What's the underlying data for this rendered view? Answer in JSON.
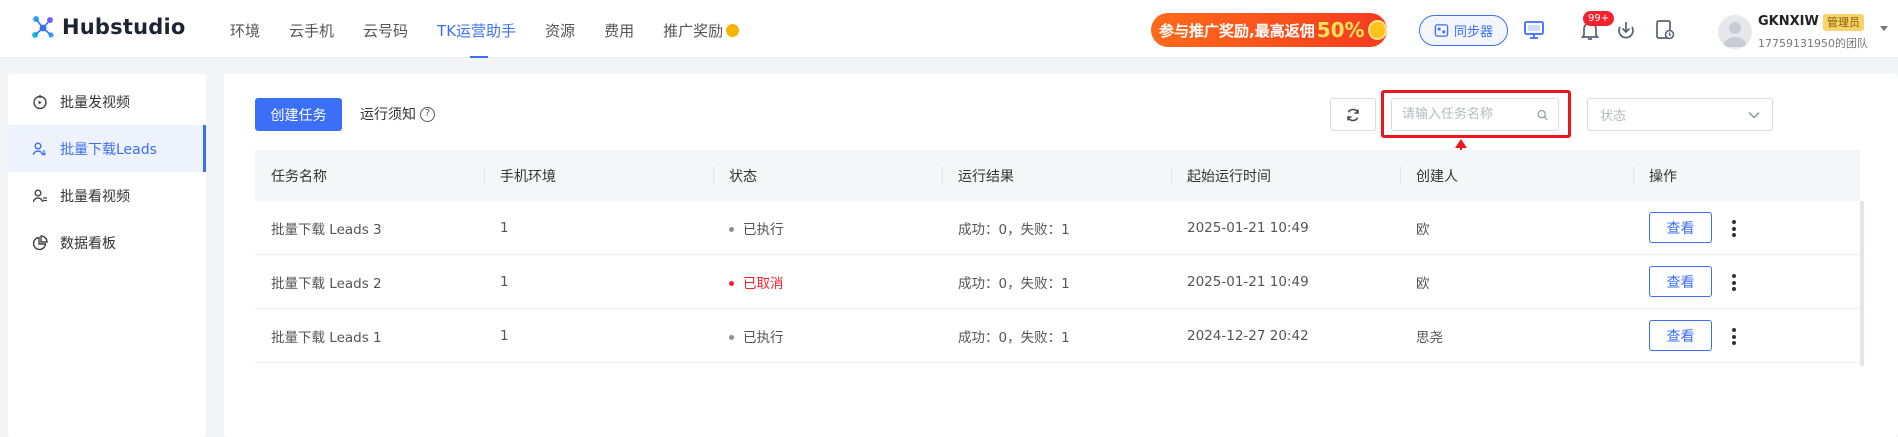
{
  "header": {
    "logo": "Hubstudio",
    "nav": [
      {
        "label": "环境",
        "active": false
      },
      {
        "label": "云手机",
        "active": false
      },
      {
        "label": "云号码",
        "active": false
      },
      {
        "label": "TK运营助手",
        "active": true
      },
      {
        "label": "资源",
        "active": false
      },
      {
        "label": "费用",
        "active": false
      },
      {
        "label": "推广奖励",
        "active": false
      }
    ],
    "promo": {
      "text": "参与推广奖励,最高返佣",
      "highlight": "50%"
    },
    "sync_label": "同步器",
    "notification_badge": "99+",
    "user": {
      "name": "GKNXIW",
      "role": "管理员",
      "team": "17759131950的团队"
    }
  },
  "sidebar": {
    "items": [
      {
        "label": "批量发视频",
        "icon": "upload-video-icon",
        "active": false
      },
      {
        "label": "批量下载Leads",
        "icon": "users-download-icon",
        "active": true
      },
      {
        "label": "批量看视频",
        "icon": "users-watch-icon",
        "active": false
      },
      {
        "label": "数据看板",
        "icon": "pie-chart-icon",
        "active": false
      }
    ]
  },
  "toolbar": {
    "create_label": "创建任务",
    "notice_label": "运行须知",
    "search_placeholder": "请输入任务名称",
    "status_placeholder": "状态"
  },
  "table": {
    "columns": [
      "任务名称",
      "手机环境",
      "状态",
      "运行结果",
      "起始运行时间",
      "创建人",
      "操作"
    ],
    "rows": [
      {
        "name": "批量下载 Leads 3",
        "env": "1",
        "status": "已执行",
        "cancelled": false,
        "result": "成功：0，失败：1",
        "time": "2025-01-21 10:49",
        "creator": "欧",
        "action": "查看"
      },
      {
        "name": "批量下载 Leads 2",
        "env": "1",
        "status": "已取消",
        "cancelled": true,
        "result": "成功：0，失败：1",
        "time": "2025-01-21 10:49",
        "creator": "欧",
        "action": "查看"
      },
      {
        "name": "批量下载 Leads 1",
        "env": "1",
        "status": "已执行",
        "cancelled": false,
        "result": "成功：0，失败：1",
        "time": "2024-12-27 20:42",
        "creator": "思尧",
        "action": "查看"
      }
    ]
  },
  "colors": {
    "accent": "#3b6ff5",
    "danger": "#f5222d",
    "highlight_box": "#f0141e",
    "promo": "#f5521f"
  }
}
